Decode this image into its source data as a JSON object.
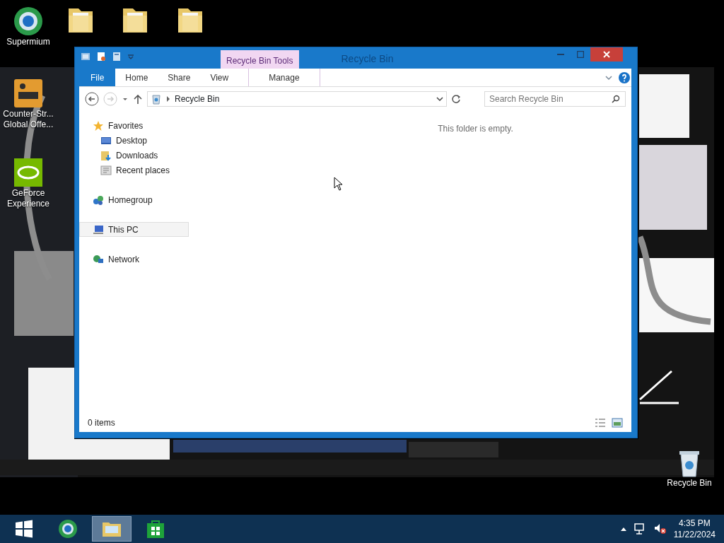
{
  "desktop_icons": [
    {
      "kind": "browser",
      "lines": [
        "Supermium"
      ]
    },
    {
      "kind": "folder"
    },
    {
      "kind": "folder"
    },
    {
      "kind": "folder"
    },
    {
      "kind": "game",
      "lines": [
        "Counter-Str...",
        "Global Offe..."
      ]
    },
    {
      "kind": "gpu",
      "lines": [
        "GeForce",
        "Experience"
      ]
    },
    {
      "kind": "bin",
      "lines": [
        "Recycle Bin"
      ]
    }
  ],
  "window": {
    "title": "Recycle Bin",
    "context_group": "Recycle Bin Tools",
    "ribbon_tabs": [
      {
        "label": "File",
        "kind": "file"
      },
      {
        "label": "Home",
        "kind": "tab"
      },
      {
        "label": "Share",
        "kind": "tab"
      },
      {
        "label": "View",
        "kind": "tab"
      },
      {
        "label": "Manage",
        "kind": "context"
      }
    ],
    "address": "Recycle Bin",
    "search": {
      "placeholder": "Search Recycle Bin"
    },
    "nav": [
      {
        "label": "Favorites",
        "kind": "star",
        "selected": false,
        "children": [
          {
            "label": "Desktop",
            "kind": "desktop",
            "selected": false
          },
          {
            "label": "Downloads",
            "kind": "downloads",
            "selected": false
          },
          {
            "label": "Recent places",
            "kind": "recent",
            "selected": false
          }
        ]
      },
      {
        "label": "Homegroup",
        "kind": "homegroup",
        "selected": false
      },
      {
        "label": "This PC",
        "kind": "pc",
        "selected": true
      },
      {
        "label": "Network",
        "kind": "network",
        "selected": false
      }
    ],
    "empty_message": "This folder is empty.",
    "status": "0 items"
  },
  "taskbar": {
    "buttons": [
      {
        "kind": "start",
        "active": false
      },
      {
        "kind": "browser",
        "active": false
      },
      {
        "kind": "explorer",
        "active": true
      },
      {
        "kind": "store",
        "active": false
      }
    ],
    "time": "4:35 PM",
    "date": "11/22/2024"
  }
}
